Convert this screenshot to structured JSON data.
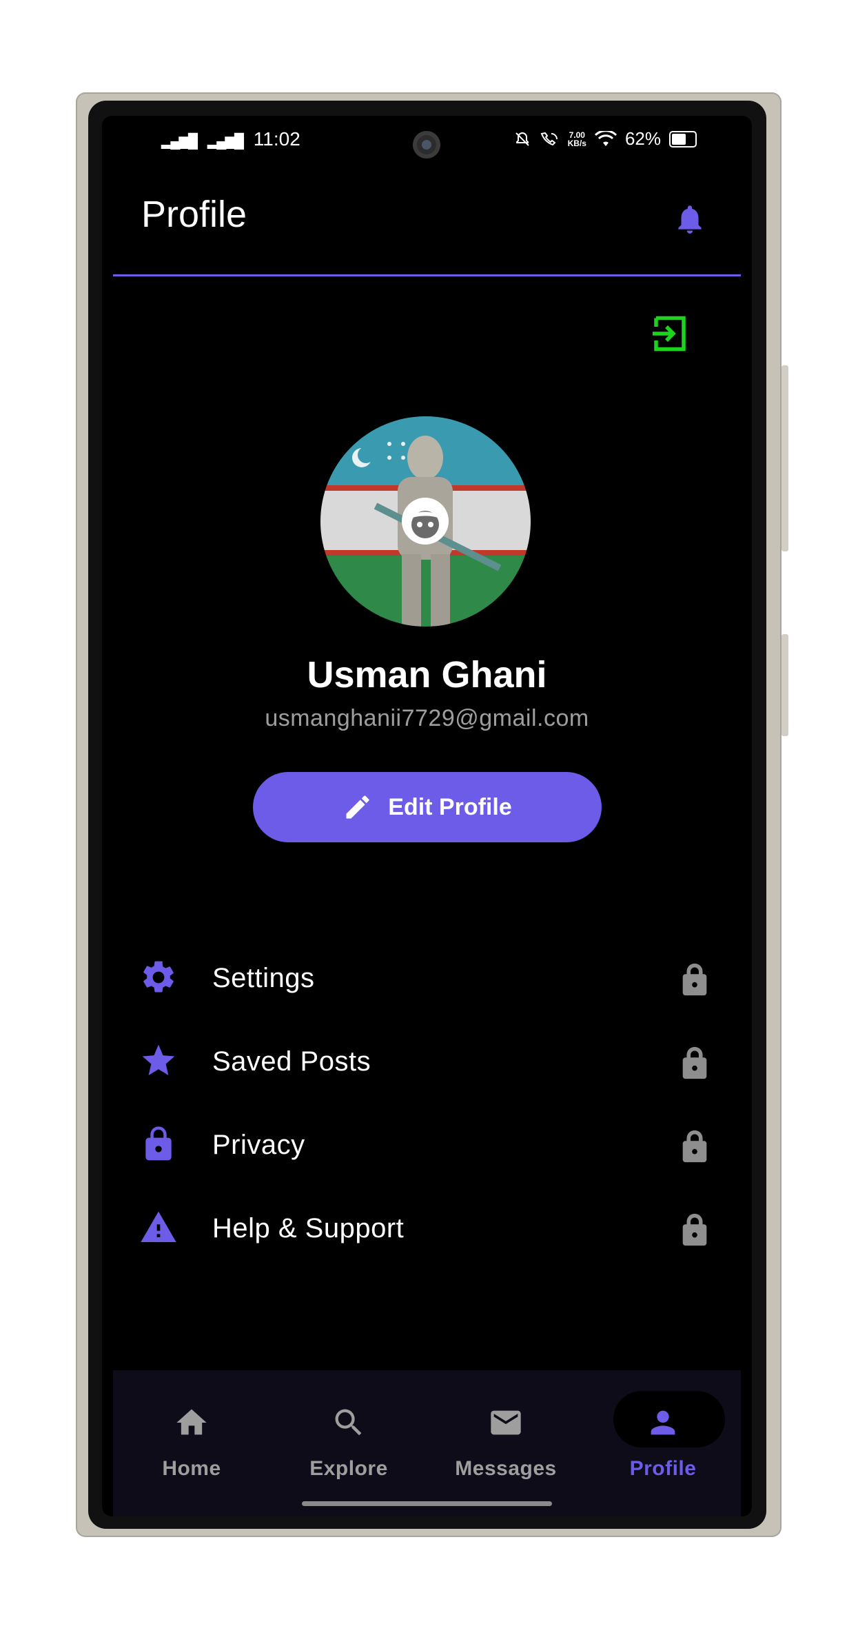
{
  "colors": {
    "accent": "#6c5ce7",
    "logout": "#1ed31e",
    "muted": "#9e9e9e",
    "background": "#000000"
  },
  "status_bar": {
    "time": "11:02",
    "battery": "62%",
    "battery_level": 0.62,
    "speed_top": "7.00",
    "speed_unit": "KB/s"
  },
  "header": {
    "title": "Profile",
    "notification_icon": "bell-icon"
  },
  "profile": {
    "name": "Usman Ghani",
    "email": "usmanghanii7729@gmail.com",
    "edit_label": "Edit Profile",
    "logout_icon": "logout-icon"
  },
  "menu": {
    "items": [
      {
        "label": "Settings",
        "icon": "gear-icon"
      },
      {
        "label": "Saved Posts",
        "icon": "star-icon"
      },
      {
        "label": "Privacy",
        "icon": "lock-icon"
      },
      {
        "label": "Help & Support",
        "icon": "warning-icon"
      }
    ]
  },
  "bottom_nav": {
    "items": [
      {
        "label": "Home",
        "icon": "home-icon"
      },
      {
        "label": "Explore",
        "icon": "search-icon"
      },
      {
        "label": "Messages",
        "icon": "mail-icon"
      },
      {
        "label": "Profile",
        "icon": "person-icon",
        "active": true
      }
    ]
  }
}
